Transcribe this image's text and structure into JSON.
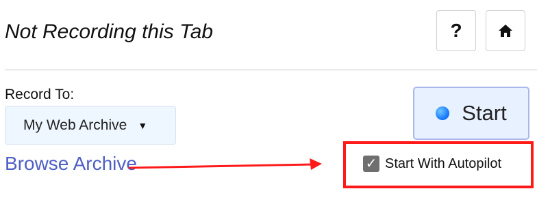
{
  "header": {
    "title": "Not Recording this Tab",
    "help_icon": "question-mark-icon",
    "help_glyph": "?",
    "home_icon": "home-icon",
    "home_glyph": "🏠"
  },
  "record": {
    "label": "Record To:",
    "archive": {
      "selected": "My Web Archive",
      "caret": "▼"
    }
  },
  "start_button": {
    "label": "Start",
    "dot_color": "#1e88ff"
  },
  "browse_link": {
    "label": "Browse Archive",
    "color": "#4d5fc4"
  },
  "autopilot": {
    "label": "Start With Autopilot",
    "checked": true,
    "check_glyph": "✓"
  },
  "annotation": {
    "color": "#ff1a1a"
  }
}
